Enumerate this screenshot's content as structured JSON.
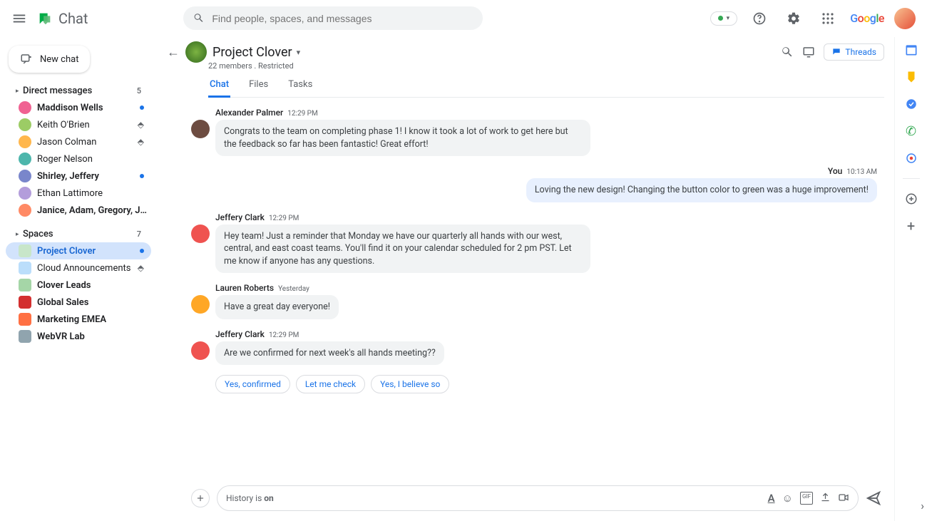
{
  "header": {
    "app_name": "Chat",
    "search_placeholder": "Find people, spaces, and messages",
    "status_label": "",
    "google_letters": [
      "G",
      "o",
      "o",
      "g",
      "l",
      "e"
    ]
  },
  "sidebar": {
    "new_chat_label": "New chat",
    "dm_section": {
      "label": "Direct messages",
      "count": "5"
    },
    "dms": [
      {
        "name": "Maddison Wells",
        "bold": true,
        "indicator": "dot",
        "color": "#f06292"
      },
      {
        "name": "Keith O'Brien",
        "bold": false,
        "indicator": "pin",
        "color": "#9ccc65"
      },
      {
        "name": "Jason Colman",
        "bold": false,
        "indicator": "pin",
        "color": "#ffb74d"
      },
      {
        "name": "Roger Nelson",
        "bold": false,
        "indicator": "",
        "color": "#4db6ac"
      },
      {
        "name": "Shirley, Jeffery",
        "bold": true,
        "indicator": "dot",
        "color": "#7986cb"
      },
      {
        "name": "Ethan Lattimore",
        "bold": false,
        "indicator": "",
        "color": "#b39ddb"
      },
      {
        "name": "Janice, Adam, Gregory, Joseph",
        "bold": true,
        "indicator": "",
        "color": "#ff8a65"
      }
    ],
    "space_section": {
      "label": "Spaces",
      "count": "7"
    },
    "spaces": [
      {
        "name": "Project Clover",
        "bold": true,
        "active": true,
        "indicator": "dot",
        "color": "#c8e6c9"
      },
      {
        "name": "Cloud Announcements",
        "bold": false,
        "active": false,
        "indicator": "pin",
        "color": "#bbdefb"
      },
      {
        "name": "Clover Leads",
        "bold": true,
        "active": false,
        "indicator": "",
        "color": "#a5d6a7"
      },
      {
        "name": "Global Sales",
        "bold": true,
        "active": false,
        "indicator": "",
        "color": "#d32f2f"
      },
      {
        "name": "Marketing EMEA",
        "bold": true,
        "active": false,
        "indicator": "",
        "color": "#ff7043"
      },
      {
        "name": "WebVR Lab",
        "bold": true,
        "active": false,
        "indicator": "",
        "color": "#90a4ae"
      }
    ]
  },
  "space_header": {
    "title": "Project Clover",
    "subtitle": "22 members . Restricted",
    "threads_label": "Threads",
    "tabs": [
      "Chat",
      "Files",
      "Tasks"
    ],
    "active_tab": 0
  },
  "messages": [
    {
      "sender": "Alexander Palmer",
      "ts": "12:29 PM",
      "own": false,
      "color": "#6d4c41",
      "text": "Congrats to the team on completing phase 1! I know it took a lot of work to get here but the feedback so far has been fantastic! Great effort!"
    },
    {
      "sender": "You",
      "ts": "10:13 AM",
      "own": true,
      "color": "",
      "text": "Loving the new design! Changing the button color to green was a huge improvement!"
    },
    {
      "sender": "Jeffery Clark",
      "ts": "12:29 PM",
      "own": false,
      "color": "#ef5350",
      "text": "Hey team! Just a reminder that Monday we have our quarterly all hands with our west, central, and east coast teams. You'll find it on your calendar scheduled for 2 pm PST. Let me know if anyone has any questions."
    },
    {
      "sender": "Lauren Roberts",
      "ts": "Yesterday",
      "own": false,
      "color": "#ffa726",
      "text": "Have a great day everyone!"
    },
    {
      "sender": "Jeffery Clark",
      "ts": "12:29 PM",
      "own": false,
      "color": "#ef5350",
      "text": "Are we confirmed for next week's all hands meeting??"
    }
  ],
  "suggestions": [
    "Yes, confirmed",
    "Let me check",
    "Yes, I believe so"
  ],
  "composer": {
    "history_prefix": "History is ",
    "history_state": "on"
  }
}
